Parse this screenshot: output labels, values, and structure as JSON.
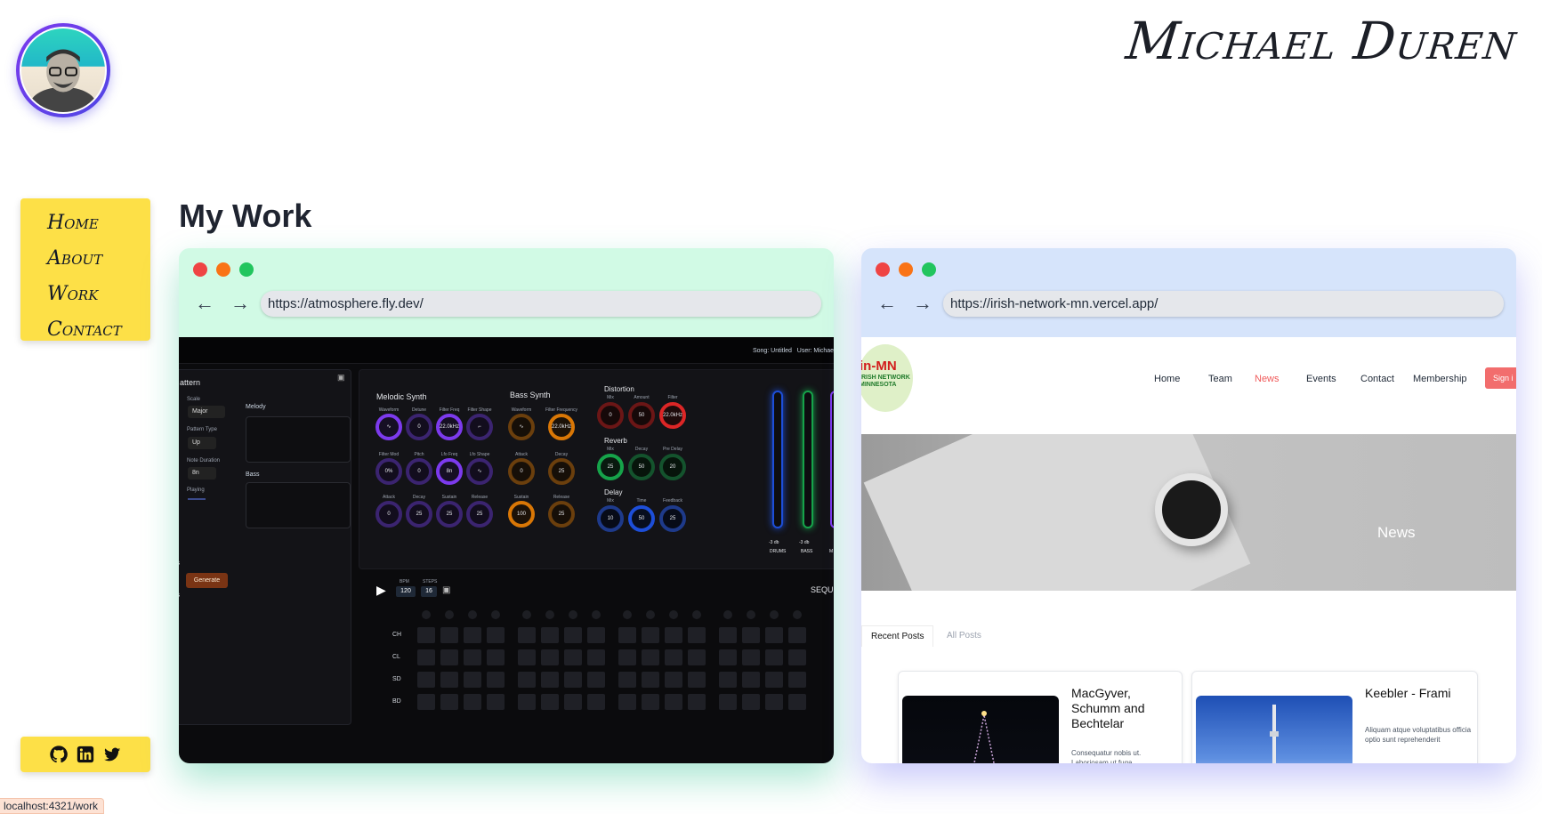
{
  "site": {
    "title": "Michael Duren"
  },
  "nav": {
    "items": [
      "Home",
      "About",
      "Work",
      "Contact"
    ]
  },
  "social": {
    "icons": [
      "github-icon",
      "linkedin-icon",
      "twitter-icon"
    ]
  },
  "main": {
    "heading": "My Work"
  },
  "projects": [
    {
      "url": "https://atmosphere.fly.dev/",
      "accent": "#d1fae5",
      "app": {
        "topbar": {
          "song": "Song: Untitled",
          "user": "User: Michae"
        },
        "pattern_panel": {
          "title": "attern",
          "scale_label": "Scale",
          "scale_value": "Major",
          "pattern_type_label": "Pattern Type",
          "pattern_type_value": "Up",
          "note_duration_label": "Note Duration",
          "note_duration_value": "8n",
          "playing_label": "Playing",
          "melody_label": "Melody",
          "bass_label": "Bass",
          "generate_label": "Generate",
          "side_a": "s",
          "side_b": "s"
        },
        "melodic_synth": {
          "title": "Melodic Synth",
          "knobs": [
            {
              "label": "Waveform",
              "value": "∿"
            },
            {
              "label": "Detune",
              "value": "0"
            },
            {
              "label": "Filter Freq",
              "value": "22.0kHz"
            },
            {
              "label": "Filter Shape",
              "value": "⌐"
            },
            {
              "label": "Filter Mod",
              "value": "0%"
            },
            {
              "label": "Pitch",
              "value": "0"
            },
            {
              "label": "Lfo Freq",
              "value": "8n"
            },
            {
              "label": "Lfo Shape",
              "value": "∿"
            },
            {
              "label": "Attack",
              "value": "0"
            },
            {
              "label": "Decay",
              "value": "25"
            },
            {
              "label": "Sustain",
              "value": "25"
            },
            {
              "label": "Release",
              "value": "25"
            }
          ]
        },
        "bass_synth": {
          "title": "Bass Synth",
          "knobs": [
            {
              "label": "Waveform",
              "value": "∿"
            },
            {
              "label": "Filter Frequency",
              "value": "22.0kHz"
            },
            {
              "label": "Attack",
              "value": "0"
            },
            {
              "label": "Decay",
              "value": "25"
            },
            {
              "label": "Sustain",
              "value": "100"
            },
            {
              "label": "Release",
              "value": "25"
            }
          ]
        },
        "effects": {
          "distortion": {
            "title": "Distortion",
            "knobs": [
              {
                "label": "Mix",
                "value": "0"
              },
              {
                "label": "Amount",
                "value": "50"
              },
              {
                "label": "Filter",
                "value": "22.0kHz"
              }
            ]
          },
          "reverb": {
            "title": "Reverb",
            "knobs": [
              {
                "label": "Mix",
                "value": "25"
              },
              {
                "label": "Decay",
                "value": "50"
              },
              {
                "label": "Pre Delay",
                "value": "20"
              }
            ]
          },
          "delay": {
            "title": "Delay",
            "knobs": [
              {
                "label": "Mix",
                "value": "10"
              },
              {
                "label": "Time",
                "value": "50"
              },
              {
                "label": "Feedback",
                "value": "25"
              }
            ]
          }
        },
        "mixer": {
          "faders": [
            {
              "db": "-3 db",
              "name": "DRUMS"
            },
            {
              "db": "-3 db",
              "name": "BASS"
            },
            {
              "db": "",
              "name": "M"
            }
          ]
        },
        "transport": {
          "bpm_label": "BPM",
          "bpm": "120",
          "steps_label": "STEPS",
          "steps": "16",
          "seq_label": "SEQU"
        },
        "sequencer_rows": [
          "CH",
          "CL",
          "SD",
          "BD"
        ]
      }
    },
    {
      "url": "https://irish-network-mn.vercel.app/",
      "accent": "#d6e4fb",
      "app": {
        "logo": {
          "title": "in-MN",
          "subtitle": "IRISH NETWORK MINNESOTA"
        },
        "menu": [
          "Home",
          "Team",
          "News",
          "Events",
          "Contact",
          "Membership"
        ],
        "active_menu": "News",
        "signin": "Sign i",
        "hero_title": "News",
        "tabs": [
          "Recent Posts",
          "All Posts"
        ],
        "posts": [
          {
            "title": "MacGyver, Schumm and Bechtelar",
            "excerpt": "Consequatur nobis ut. Laboriosam ut fuga"
          },
          {
            "title": "Keebler - Frami",
            "excerpt": "Aliquam atque voluptatibus officia optio sunt reprehenderit"
          }
        ]
      }
    }
  ],
  "statusbar": {
    "url": "localhost:4321/work"
  }
}
